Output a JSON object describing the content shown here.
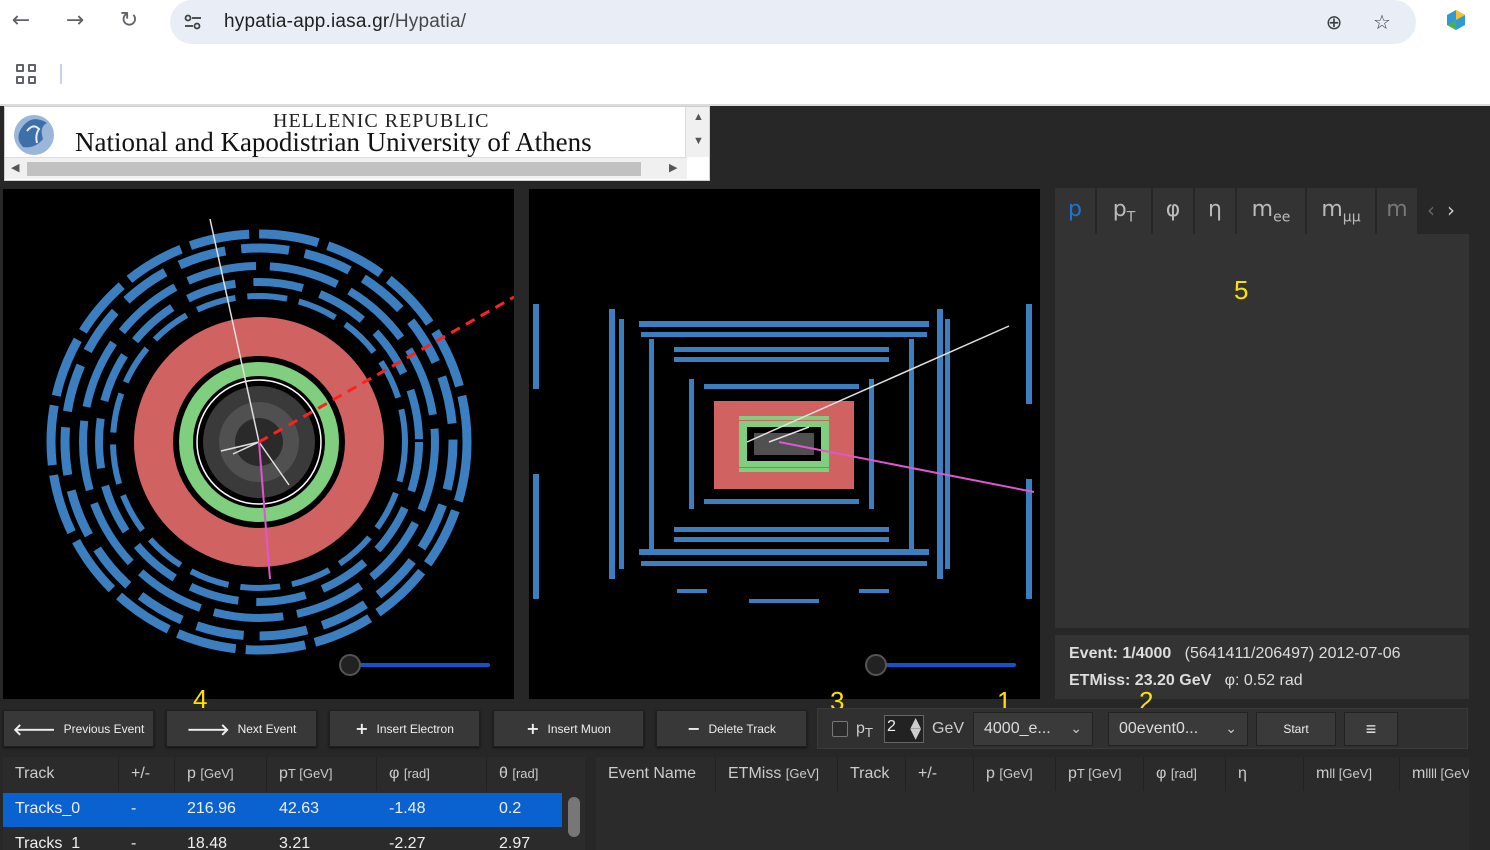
{
  "browser": {
    "url_host": "hypatia-app.iasa.gr",
    "url_path": "/Hypatia/",
    "back_icon": "←",
    "forward_icon": "→",
    "reload_icon": "↻",
    "zoom_icon": "⊕",
    "star_icon": "☆"
  },
  "banner": {
    "republic": "HELLENIC REPUBLIC",
    "university": "National and Kapodistrian University of Athens"
  },
  "annotations": {
    "n1": "1",
    "n2": "2",
    "n3": "3",
    "n4": "4",
    "n5": "5"
  },
  "histogram_tabs": [
    {
      "label": "p",
      "sub": ""
    },
    {
      "label": "p",
      "sub": "T"
    },
    {
      "label": "φ",
      "sub": ""
    },
    {
      "label": "η",
      "sub": ""
    },
    {
      "label": "m",
      "sub": "ee"
    },
    {
      "label": "m",
      "sub": "μμ"
    },
    {
      "label": "m",
      "sub": ""
    }
  ],
  "event_info": {
    "event_label": "Event: 1/4000",
    "event_detail": "(5641411/206497) 2012-07-06",
    "etmiss_label": "ETMiss: 23.20 GeV",
    "phi_label": "φ: 0.52 rad"
  },
  "toolbar": {
    "previous": "Previous Event",
    "next": "Next Event",
    "insert_electron": "Insert Electron",
    "insert_muon": "Insert Muon",
    "delete_track": "Delete Track",
    "pt_label": "p",
    "pt_sub": "T",
    "pt_value": "2",
    "gev": "GeV",
    "dataset": "4000_e...",
    "event_file": "00event0...",
    "start": "Start",
    "menu_icon": "≡"
  },
  "tracks_table": {
    "headers": [
      {
        "label": "Track",
        "unit": ""
      },
      {
        "label": "+/-",
        "unit": ""
      },
      {
        "label": "p ",
        "unit": "[GeV]"
      },
      {
        "label": "p",
        "unit": "T [GeV]"
      },
      {
        "label": "φ ",
        "unit": "[rad]"
      },
      {
        "label": "θ ",
        "unit": "[rad]"
      }
    ],
    "rows": [
      [
        "Tracks_0",
        "-",
        "216.96",
        "42.63",
        "-1.48",
        "0.2"
      ],
      [
        "Tracks_1",
        "-",
        "18.48",
        "3.21",
        "-2.27",
        "2.97"
      ]
    ]
  },
  "events_table": {
    "headers": [
      {
        "label": "Event Name",
        "unit": ""
      },
      {
        "label": "ETMiss ",
        "unit": "[GeV]"
      },
      {
        "label": "Track",
        "unit": ""
      },
      {
        "label": "+/-",
        "unit": ""
      },
      {
        "label": "p ",
        "unit": "[GeV]"
      },
      {
        "label": "p",
        "unit": "T [GeV]"
      },
      {
        "label": "φ ",
        "unit": "[rad]"
      },
      {
        "label": "η",
        "unit": ""
      },
      {
        "label": "m",
        "unit": "ll [GeV]"
      },
      {
        "label": "m",
        "unit": "llll [GeV]"
      }
    ]
  },
  "colors": {
    "app_bg": "#272727",
    "accent": "#1976d2",
    "selection": "#0a62d0",
    "annotation": "#ffe000",
    "detector_blue": "#3b7fc0",
    "calorimeter_red": "#d16262",
    "tracker_green": "#7fcf7f"
  }
}
